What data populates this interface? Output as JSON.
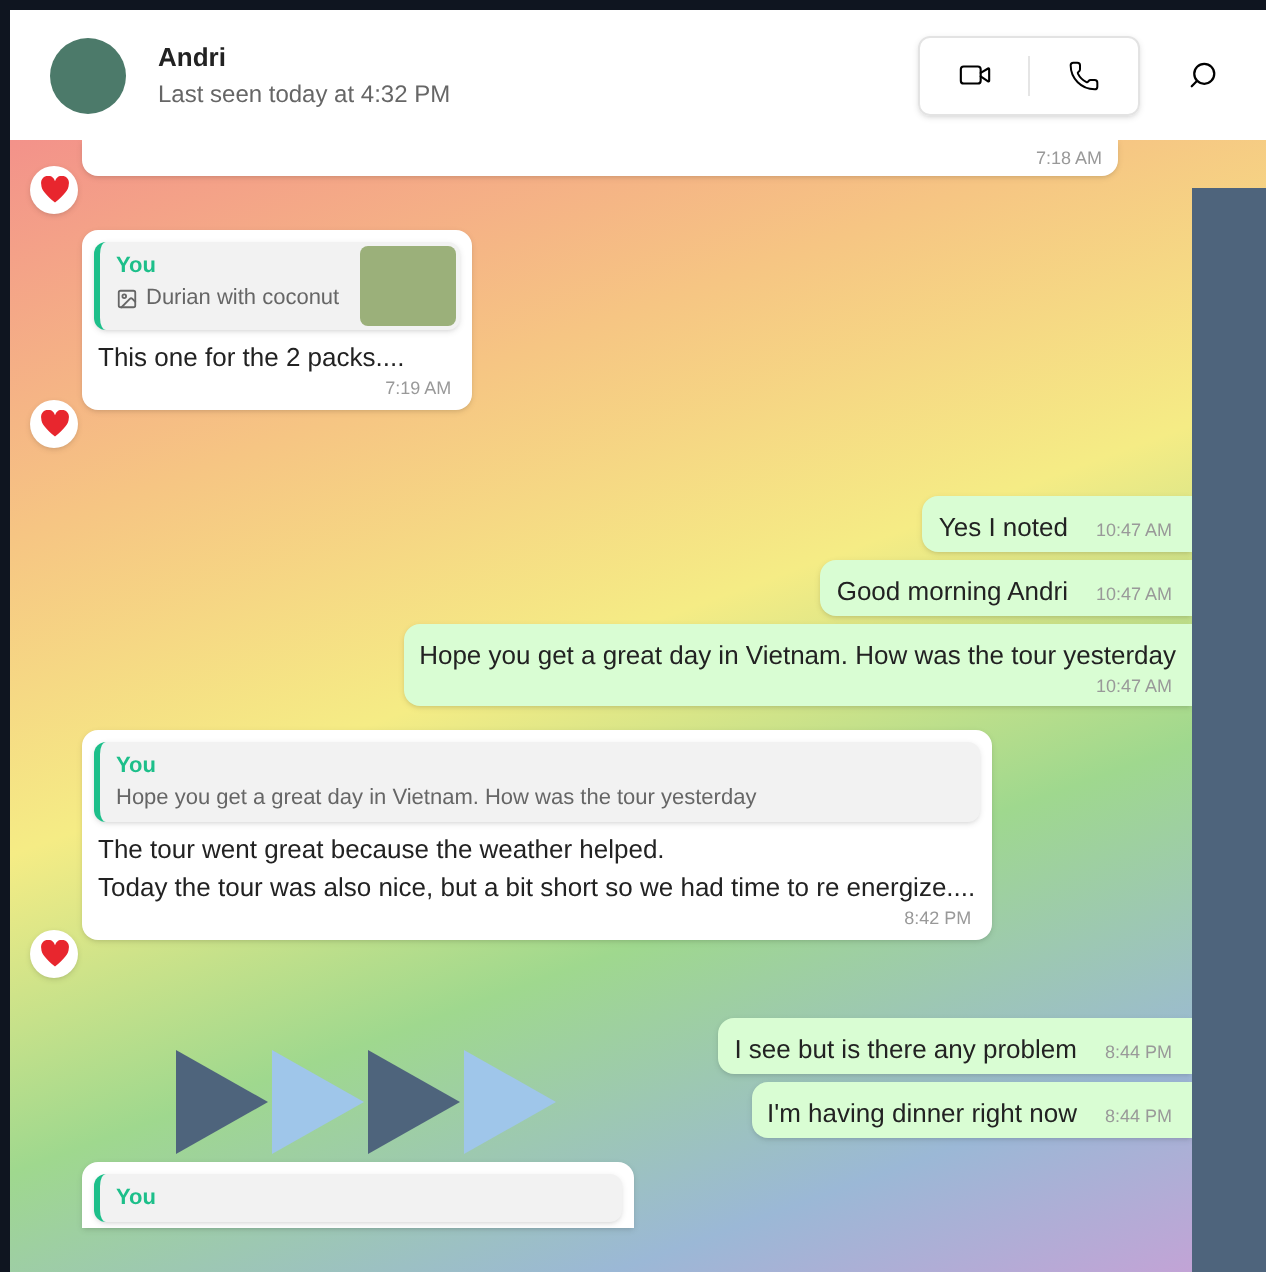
{
  "header": {
    "name": "Andri",
    "status": "Last seen today at 4:32 PM"
  },
  "messages": [
    {
      "kind": "incoming",
      "time": "7:18 AM",
      "reaction": true,
      "clipped": true
    },
    {
      "kind": "incoming",
      "reply": {
        "author": "You",
        "text": "Durian with coconut",
        "photo": true
      },
      "text": "This one for the 2 packs....",
      "time": "7:19 AM",
      "reaction": true
    },
    {
      "kind": "outgoing",
      "text": "Yes I noted",
      "time": "10:47 AM",
      "reaction": false
    },
    {
      "kind": "outgoing",
      "text": "Good morning Andri",
      "time": "10:47 AM",
      "reaction": false
    },
    {
      "kind": "outgoing",
      "text": "Hope you get a great day in Vietnam. How was the tour yesterday",
      "time": "10:47 AM",
      "reaction": false
    },
    {
      "kind": "incoming",
      "reply": {
        "author": "You",
        "text": "Hope you get a great day in Vietnam. How was the tour yesterday",
        "photo": false
      },
      "text": "The tour went great because the weather helped.\nToday the tour was also nice, but a bit short so we had time to re energize....",
      "time": "8:42 PM",
      "reaction": true
    },
    {
      "kind": "outgoing",
      "text": "I see but is there any problem",
      "time": "8:44 PM",
      "reaction": false
    },
    {
      "kind": "outgoing",
      "text": "I'm having dinner right now",
      "time": "8:44 PM",
      "reaction": false
    },
    {
      "kind": "incoming",
      "reply": {
        "author": "You"
      },
      "reaction": false,
      "partial": true
    }
  ]
}
